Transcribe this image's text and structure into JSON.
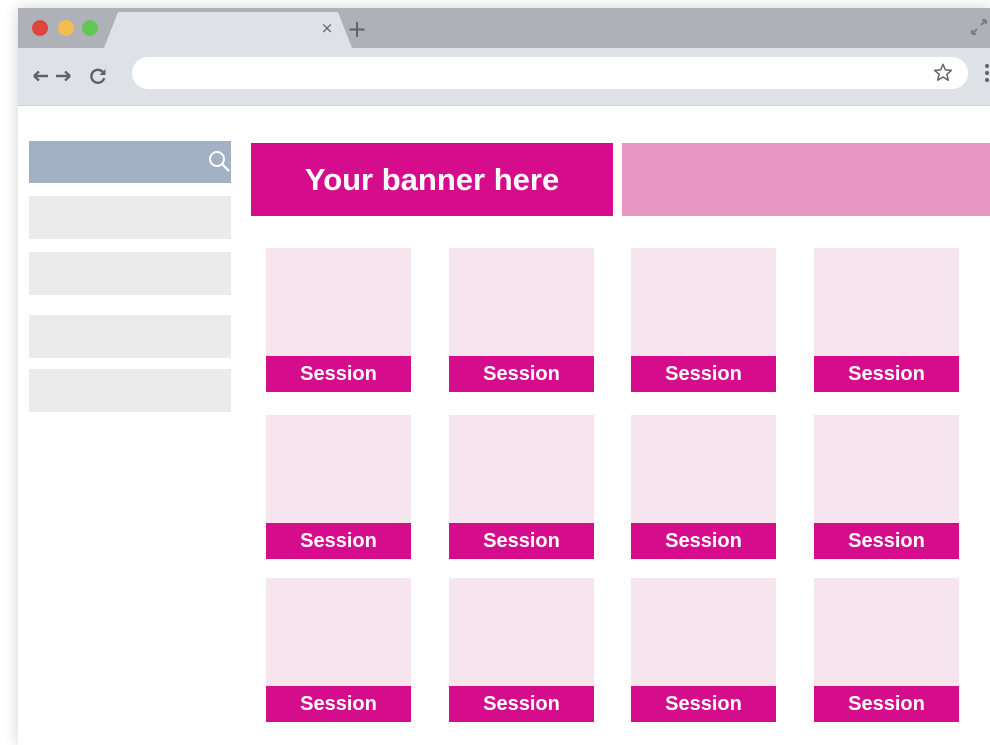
{
  "browser": {
    "tab": {
      "close_glyph": "×",
      "new_tab_glyph": "+"
    },
    "address_bar": {
      "value": "",
      "placeholder": ""
    },
    "icons": [
      "back-arrow-icon",
      "forward-arrow-icon",
      "reload-icon",
      "star-icon",
      "kebab-menu-icon",
      "expand-icon"
    ]
  },
  "sidebar": {
    "search": {
      "value": "",
      "placeholder": "",
      "icon": "search-icon"
    },
    "items": [
      "",
      "",
      "",
      ""
    ]
  },
  "banner": {
    "primary_text": "Your banner here",
    "secondary_text": ""
  },
  "sessions": [
    {
      "label": "Session"
    },
    {
      "label": "Session"
    },
    {
      "label": "Session"
    },
    {
      "label": "Session"
    },
    {
      "label": "Session"
    },
    {
      "label": "Session"
    },
    {
      "label": "Session"
    },
    {
      "label": "Session"
    },
    {
      "label": "Session"
    },
    {
      "label": "Session"
    },
    {
      "label": "Session"
    },
    {
      "label": "Session"
    }
  ],
  "colors": {
    "accent": "#d50d8c",
    "accent_light": "#e697c2",
    "card_bg": "#f6e4ef",
    "search_bg": "#a2b1c6",
    "sidebar_item_bg": "#ebebeb",
    "chrome_bg": "#dee1e6",
    "tabstrip_bg": "#aeb2b8"
  }
}
